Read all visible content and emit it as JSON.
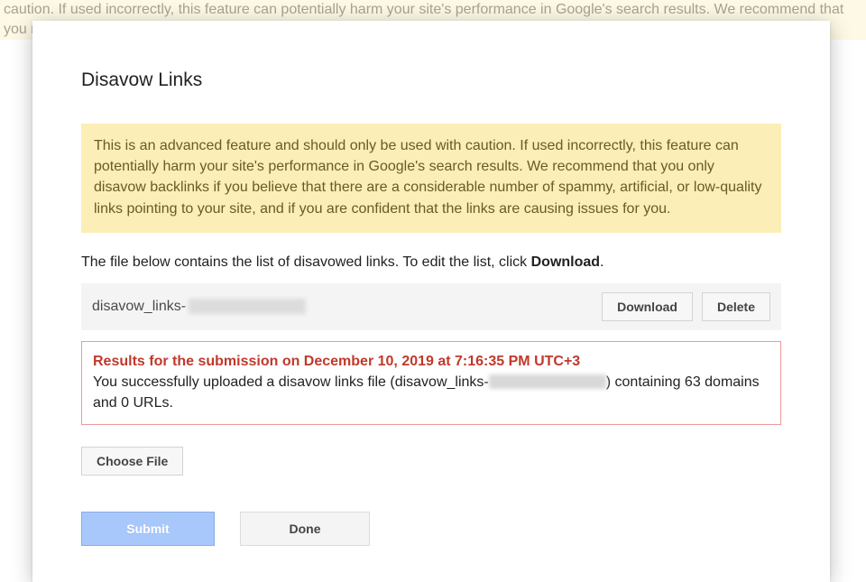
{
  "background_banner_text": "caution. If used incorrectly, this feature can potentially harm your site's performance in Google's search results. We recommend that you nks pointing to your site, and if you are confident that the links are causing issues for you.",
  "dialog": {
    "title": "Disavow Links",
    "warning_text": "This is an advanced feature and should only be used with caution. If used incorrectly, this feature can potentially harm your site's performance in Google's search results. We recommend that you only disavow backlinks if you believe that there are a considerable number of spammy, artificial, or low-quality links pointing to your site, and if you are confident that the links are causing issues for you.",
    "instruction_prefix": "The file below contains the list of disavowed links. To edit the list, click ",
    "instruction_bold": "Download",
    "instruction_suffix": ".",
    "file_row": {
      "prefix": "disavow_links-",
      "download_label": "Download",
      "delete_label": "Delete"
    },
    "result": {
      "heading": "Results for the submission on December 10, 2019 at 7:16:35 PM UTC+3",
      "message_prefix": "You successfully uploaded a disavow links file (disavow_links-",
      "message_suffix": ") containing 63 domains and 0 URLs."
    },
    "choose_file_label": "Choose File",
    "submit_label": "Submit",
    "done_label": "Done"
  }
}
